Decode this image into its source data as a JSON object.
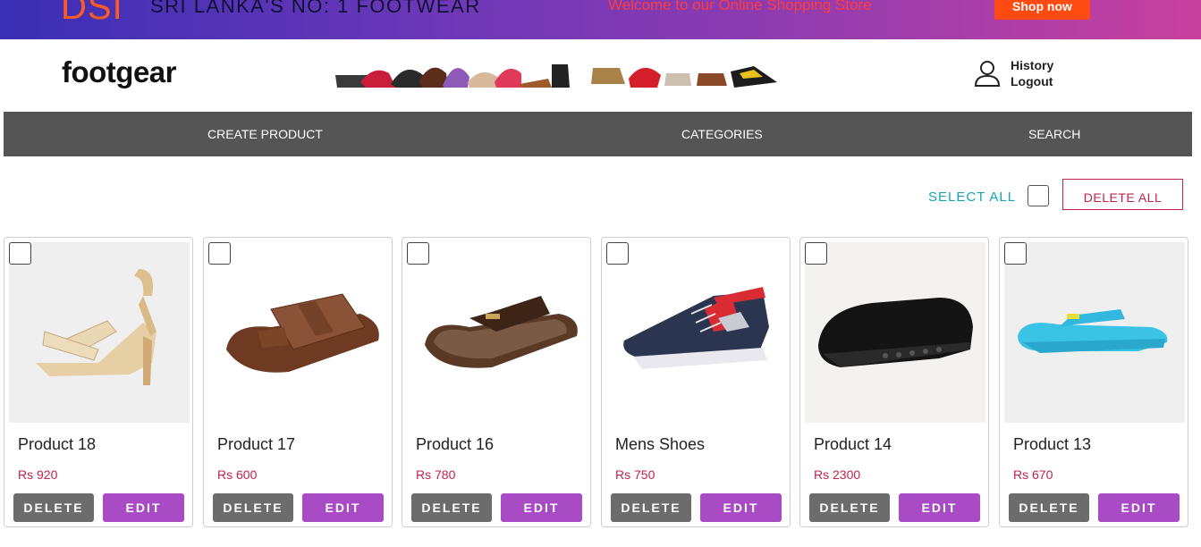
{
  "promo": {
    "brand": "DSI",
    "tagline": "SRI LANKA'S NO: 1 FOOTWEAR",
    "welcome": "Welcome to our Online Shopping Store",
    "shop_now": "Shop now"
  },
  "header": {
    "logo": "footgear",
    "history": "History",
    "logout": "Logout"
  },
  "nav": {
    "create_product": "CREATE PRODUCT",
    "categories": "CATEGORIES",
    "search": "SEARCH"
  },
  "bulk": {
    "select_all": "SELECT ALL",
    "delete_all": "DELETE ALL"
  },
  "colors": {
    "nav_bg": "#555555",
    "price": "#c0224a",
    "edit_button": "#a94bc4",
    "delete_button": "#6c6c6c",
    "select_all": "#17a2b8"
  },
  "products": [
    {
      "name": "Product 18",
      "price": "Rs 920",
      "delete": "DELETE",
      "edit": "EDIT",
      "image": "beige-heel-sandal"
    },
    {
      "name": "Product 17",
      "price": "Rs 600",
      "delete": "DELETE",
      "edit": "EDIT",
      "image": "brown-leather-slipper"
    },
    {
      "name": "Product 16",
      "price": "Rs 780",
      "delete": "DELETE",
      "edit": "EDIT",
      "image": "brown-thong-sandal"
    },
    {
      "name": "Mens Shoes",
      "price": "Rs 750",
      "delete": "DELETE",
      "edit": "EDIT",
      "image": "navy-sneaker"
    },
    {
      "name": "Product 14",
      "price": "Rs 2300",
      "delete": "DELETE",
      "edit": "EDIT",
      "image": "black-clog"
    },
    {
      "name": "Product 13",
      "price": "Rs 670",
      "delete": "DELETE",
      "edit": "EDIT",
      "image": "blue-flip-flop"
    }
  ]
}
